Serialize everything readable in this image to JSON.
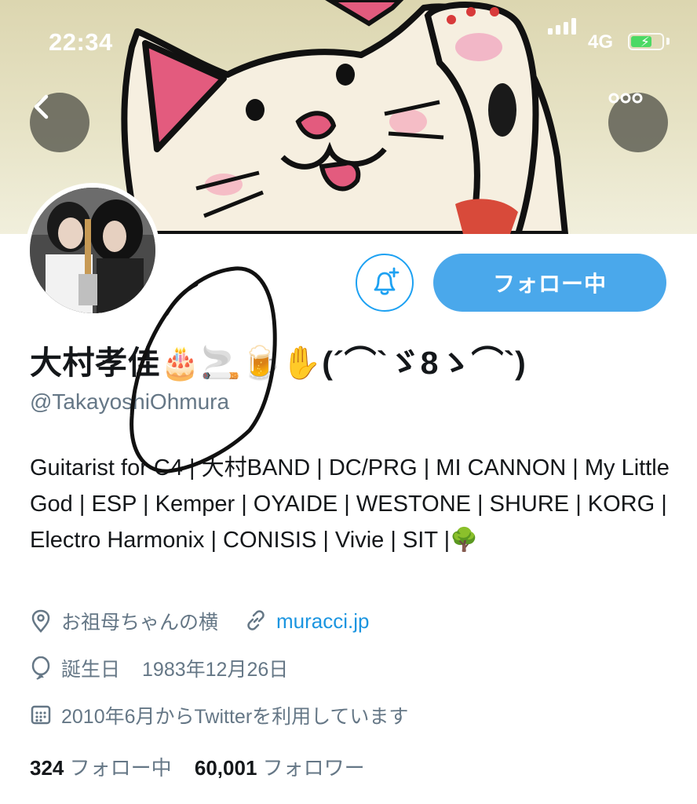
{
  "status_bar": {
    "time": "22:34",
    "network": "4G"
  },
  "profile": {
    "display_name": "大村孝佳🎂🚬🍺✋(´⌒`ゞ8ゝ⌒`)",
    "handle": "@TakayoshiOhmura",
    "bio": "Guitarist for C4 | 大村BAND | DC/PRG | MI CANNON | My Little God | ESP | Kemper | OYAIDE | WESTONE | SHURE | KORG | Electro Harmonix | CONISIS | Vivie | SIT |🌳",
    "location": "お祖母ちゃんの横",
    "website": "muracci.jp",
    "birthday_label": "誕生日",
    "birthday": "1983年12月26日",
    "joined": "2010年6月からTwitterを利用しています",
    "following_count": "324",
    "following_label": "フォロー中",
    "followers_count": "60,001",
    "followers_label": "フォロワー"
  },
  "actions": {
    "follow_button_label": "フォロー中",
    "notify_icon": "bell-plus-icon",
    "back_icon": "chevron-left-icon",
    "more_icon": "more-horizontal-icon"
  },
  "colors": {
    "accent": "#1da1f2",
    "follow_button": "#4aa8eb",
    "secondary_text": "#657786",
    "link": "#1b95e0"
  }
}
